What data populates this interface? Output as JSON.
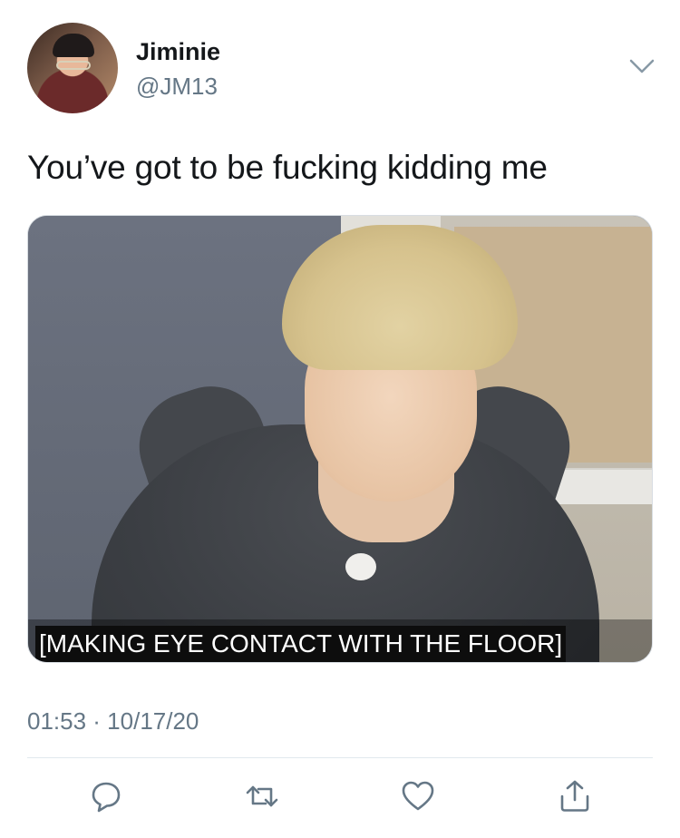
{
  "author": {
    "display_name": "Jiminie",
    "handle": "@JM13",
    "avatar_icon": "profile-photo"
  },
  "tweet": {
    "text": "You’ve got to be fucking kidding me",
    "media": {
      "caption": "[MAKING EYE CONTACT WITH THE FLOOR]"
    },
    "timestamp": "01:53 · 10/17/20"
  },
  "actions": [
    {
      "icon": "reply-icon"
    },
    {
      "icon": "retweet-icon"
    },
    {
      "icon": "like-icon"
    },
    {
      "icon": "share-icon"
    }
  ],
  "colors": {
    "primary_text": "#14171a",
    "secondary_text": "#657786",
    "divider": "#e1e8ed"
  }
}
